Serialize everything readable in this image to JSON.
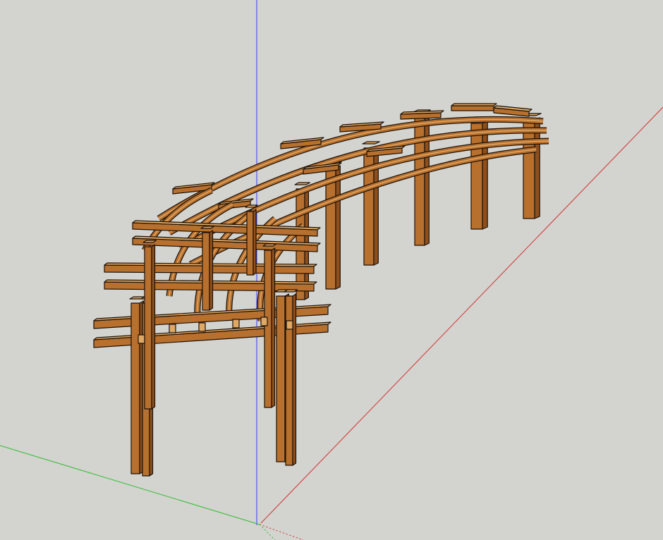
{
  "viewport": {
    "view": "perspective",
    "background_color": "#d3d3cf"
  },
  "axes": {
    "blue_axis_color": "#3a3aff",
    "red_axis_color": "#d23232",
    "green_axis_color": "#2fbf2f"
  },
  "model": {
    "description": "curved-wooden-pergola",
    "wood_color": "#b8702e",
    "wood_dark_color": "#8f4f1c",
    "wood_light_color": "#e0a865",
    "edge_color": "#1c1208",
    "post_count_front_row": 8,
    "post_count_back_row": 7,
    "arched_rafter_count": 5
  }
}
